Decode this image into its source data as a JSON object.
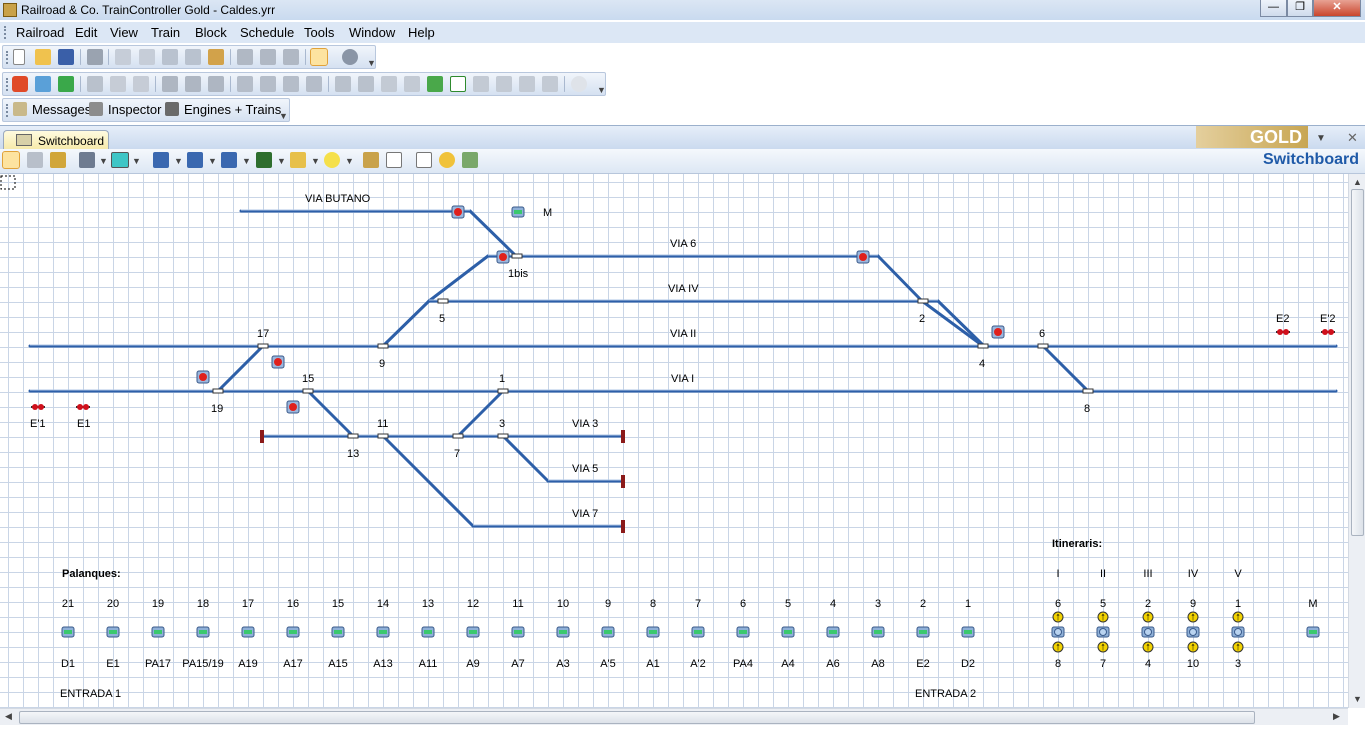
{
  "window": {
    "title": "Railroad & Co. TrainController Gold - Caldes.yrr",
    "controls": {
      "minimize": "—",
      "maximize": "❐",
      "close": "✕"
    }
  },
  "menu": [
    "Railroad",
    "Edit",
    "View",
    "Train",
    "Block",
    "Schedule",
    "Tools",
    "Window",
    "Help"
  ],
  "panels": {
    "messages": "Messages",
    "inspector": "Inspector",
    "engines": "Engines + Trains"
  },
  "doc_tab": "Switchboard",
  "logo_text": "GOLD",
  "switchboard_title": "Switchboard",
  "colors": {
    "track": "#2d5fa8",
    "signal_red": "#e0201c",
    "grid": "#c9d5e6",
    "end_stop": "#8b1a1a"
  },
  "track_labels": {
    "via_butano": "VIA BUTANO",
    "via_6": "VIA 6",
    "via_iv": "VIA IV",
    "via_ii": "VIA II",
    "via_i": "VIA I",
    "via_3": "VIA 3",
    "via_5": "VIA 5",
    "via_7": "VIA 7",
    "m": "M"
  },
  "switch_numbers": {
    "s1bis": "1bis",
    "s5": "5",
    "s2": "2",
    "s17": "17",
    "s9": "9",
    "s4": "4",
    "s6": "6",
    "s15": "15",
    "s1": "1",
    "s19": "19",
    "s8": "8",
    "s11": "11",
    "s3": "3",
    "s13": "13",
    "s7": "7"
  },
  "endpoints": {
    "e1p": "E'1",
    "e1": "E1",
    "e2": "E2",
    "e2p": "E'2"
  },
  "palanques": {
    "heading": "Palanques:",
    "numbers": [
      "21",
      "20",
      "19",
      "18",
      "17",
      "16",
      "15",
      "14",
      "13",
      "12",
      "11",
      "10",
      "9",
      "8",
      "7",
      "6",
      "5",
      "4",
      "3",
      "2",
      "1"
    ],
    "labels": [
      "D1",
      "E1",
      "PA17",
      "PA15/19",
      "A19",
      "A17",
      "A15",
      "A13",
      "A11",
      "A9",
      "A7",
      "A3",
      "A'5",
      "A1",
      "A'2",
      "PA4",
      "A4",
      "A6",
      "A8",
      "E2",
      "D2"
    ]
  },
  "itineraris": {
    "heading": "Itineraris:",
    "routes": [
      "I",
      "II",
      "III",
      "IV",
      "V"
    ],
    "from": [
      "6",
      "5",
      "2",
      "9",
      "1"
    ],
    "to": [
      "8",
      "7",
      "4",
      "10",
      "3"
    ],
    "extra_label": "M"
  },
  "entrada": {
    "left": "ENTRADA 1",
    "right": "ENTRADA 2"
  }
}
